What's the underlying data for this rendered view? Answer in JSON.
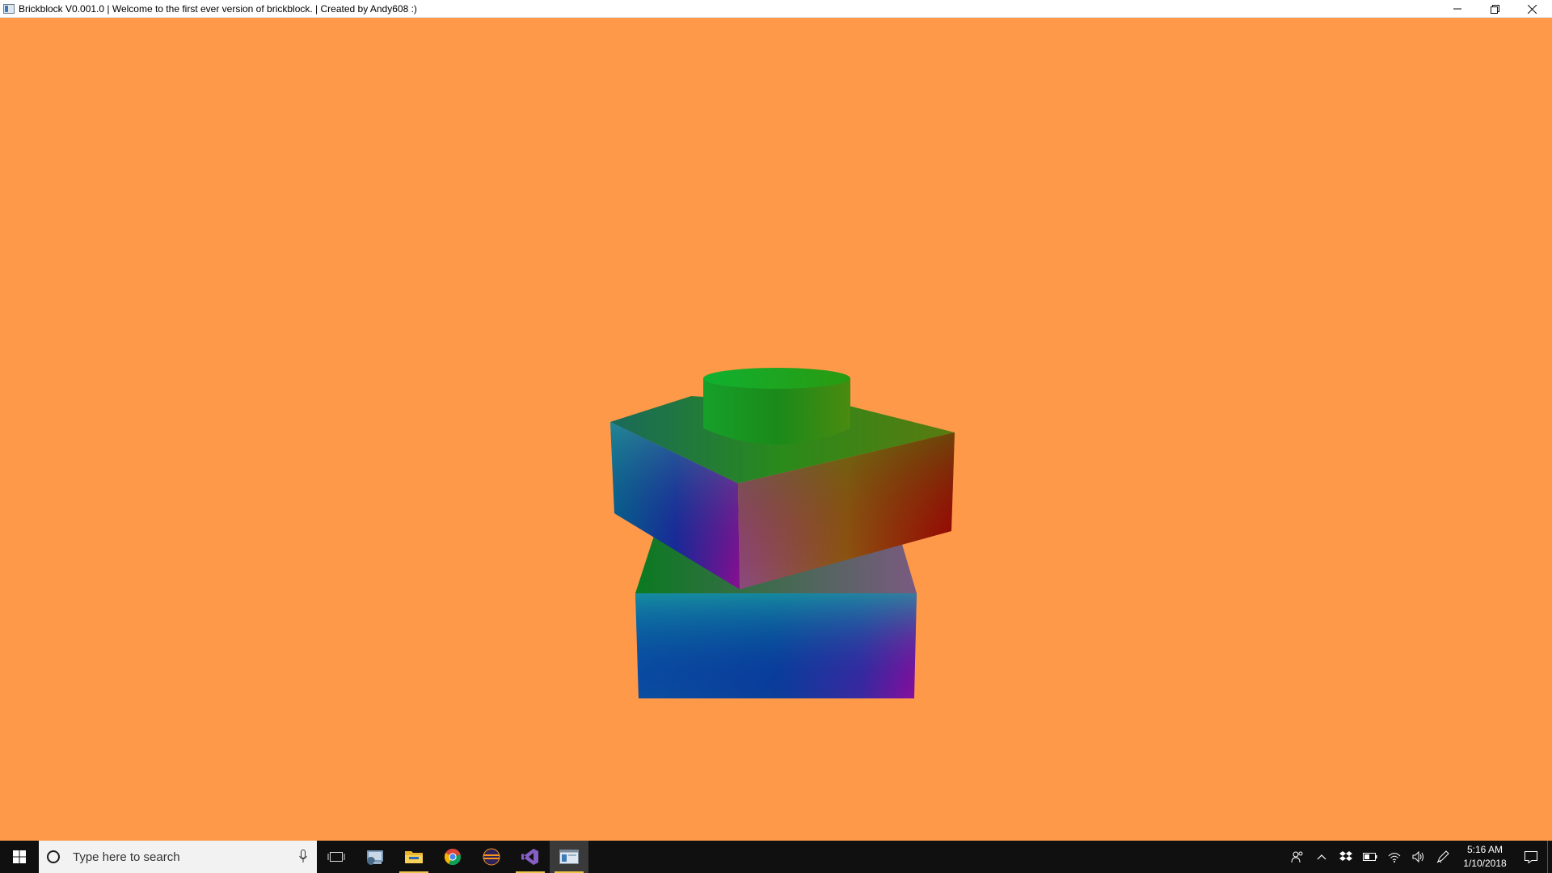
{
  "window": {
    "title": "Brickblock V0.001.0 | Welcome to the first ever version of brickblock. | Created by Andy608 :)",
    "controls": [
      "minimize-icon",
      "restore-icon",
      "close-icon"
    ]
  },
  "viewport": {
    "background_color": "#ff994a",
    "scene": "two stacked rainbow-shaded bricks with a stud on top"
  },
  "taskbar": {
    "search": {
      "placeholder": "Type here to search"
    },
    "apps": [
      {
        "icon": "task-view-icon",
        "running": false
      },
      {
        "icon": "control-panel-icon",
        "running": false
      },
      {
        "icon": "file-explorer-icon",
        "running": true
      },
      {
        "icon": "chrome-icon",
        "running": false
      },
      {
        "icon": "eclipse-icon",
        "running": false
      },
      {
        "icon": "visual-studio-icon",
        "running": true
      },
      {
        "icon": "brickblock-app-icon",
        "running": true,
        "active": true
      }
    ],
    "tray": {
      "icons": [
        "people-icon",
        "chevron-up-icon",
        "dropbox-icon",
        "battery-icon",
        "wifi-icon",
        "volume-icon",
        "pen-icon"
      ],
      "time": "5:16 AM",
      "date": "1/10/2018"
    },
    "colors": {
      "background": "#101010",
      "search_bg": "#f2f2f2",
      "accent": "#f0c64a"
    }
  }
}
